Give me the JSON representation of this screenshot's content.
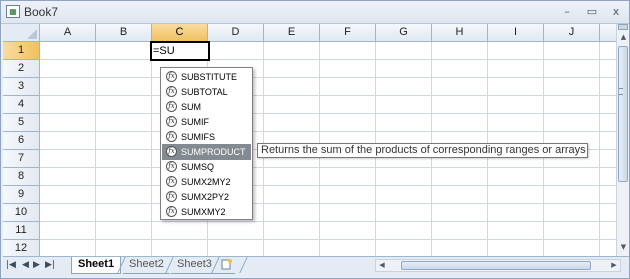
{
  "window": {
    "title": "Book7",
    "buttons": {
      "minimize": "–",
      "restore": "▭",
      "close": "x"
    }
  },
  "grid": {
    "columns": [
      "A",
      "B",
      "C",
      "D",
      "E",
      "F",
      "G",
      "H",
      "I",
      "J"
    ],
    "selected_column": "C",
    "rows": [
      "1",
      "2",
      "3",
      "4",
      "5",
      "6",
      "7",
      "8",
      "9",
      "10",
      "11",
      "12"
    ],
    "selected_row": "1",
    "active_cell": {
      "ref": "C1",
      "value": "=SU"
    }
  },
  "autocomplete": {
    "items": [
      "SUBSTITUTE",
      "SUBTOTAL",
      "SUM",
      "SUMIF",
      "SUMIFS",
      "SUMPRODUCT",
      "SUMSQ",
      "SUMX2MY2",
      "SUMX2PY2",
      "SUMXMY2"
    ],
    "highlighted": "SUMPRODUCT",
    "icon": "function-icon",
    "tooltip": "Returns the sum of the products of corresponding ranges or arrays"
  },
  "sheets": {
    "tabs": [
      "Sheet1",
      "Sheet2",
      "Sheet3"
    ],
    "active": "Sheet1",
    "nav_icons": [
      "first-sheet-icon",
      "prev-sheet-icon",
      "next-sheet-icon",
      "last-sheet-icon"
    ],
    "insert_icon": "insert-sheet-icon"
  },
  "colors": {
    "selected_header": "#f1c15f",
    "highlight_item": "#848a92",
    "gridline": "#d0d7e5"
  }
}
